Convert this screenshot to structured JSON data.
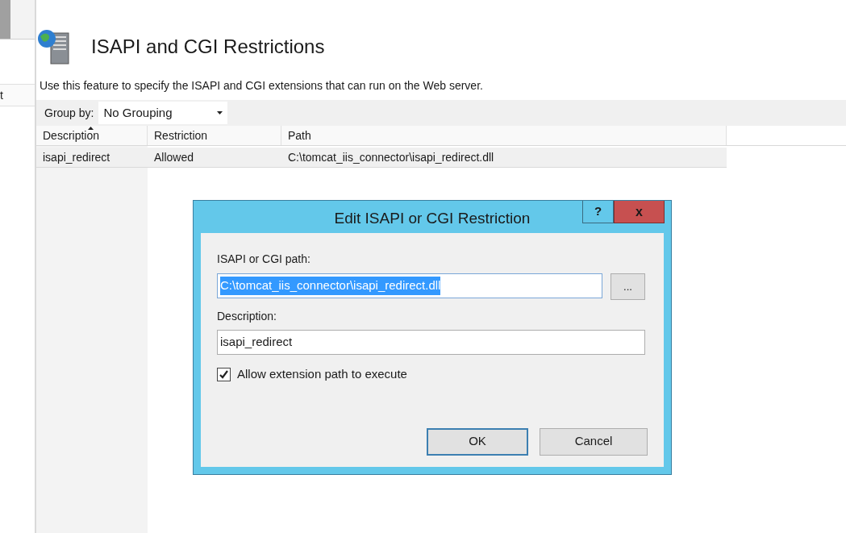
{
  "left_pane": {
    "cut_text": "t"
  },
  "header": {
    "title": "ISAPI and CGI Restrictions",
    "description": "Use this feature to specify the ISAPI and CGI extensions that can run on the Web server."
  },
  "group_by": {
    "label": "Group by:",
    "value": "No Grouping"
  },
  "table": {
    "columns": [
      {
        "label": "Description",
        "sorted": true
      },
      {
        "label": "Restriction",
        "sorted": false
      },
      {
        "label": "Path",
        "sorted": false
      }
    ],
    "rows": [
      {
        "cells": [
          "isapi_redirect",
          "Allowed",
          "C:\\tomcat_iis_connector\\isapi_redirect.dll"
        ],
        "selected": true
      }
    ]
  },
  "dialog": {
    "title": "Edit ISAPI or CGI Restriction",
    "help": "?",
    "close": "x",
    "path_label": "ISAPI or CGI path:",
    "path_value": "C:\\tomcat_iis_connector\\isapi_redirect.dll",
    "path_text_selected": true,
    "browse": "...",
    "description_label": "Description:",
    "description_value": "isapi_redirect",
    "allow": {
      "label": "Allow extension path to execute",
      "checked": true
    },
    "buttons": [
      {
        "label": "OK",
        "default": true
      },
      {
        "label": "Cancel",
        "default": false
      }
    ]
  }
}
